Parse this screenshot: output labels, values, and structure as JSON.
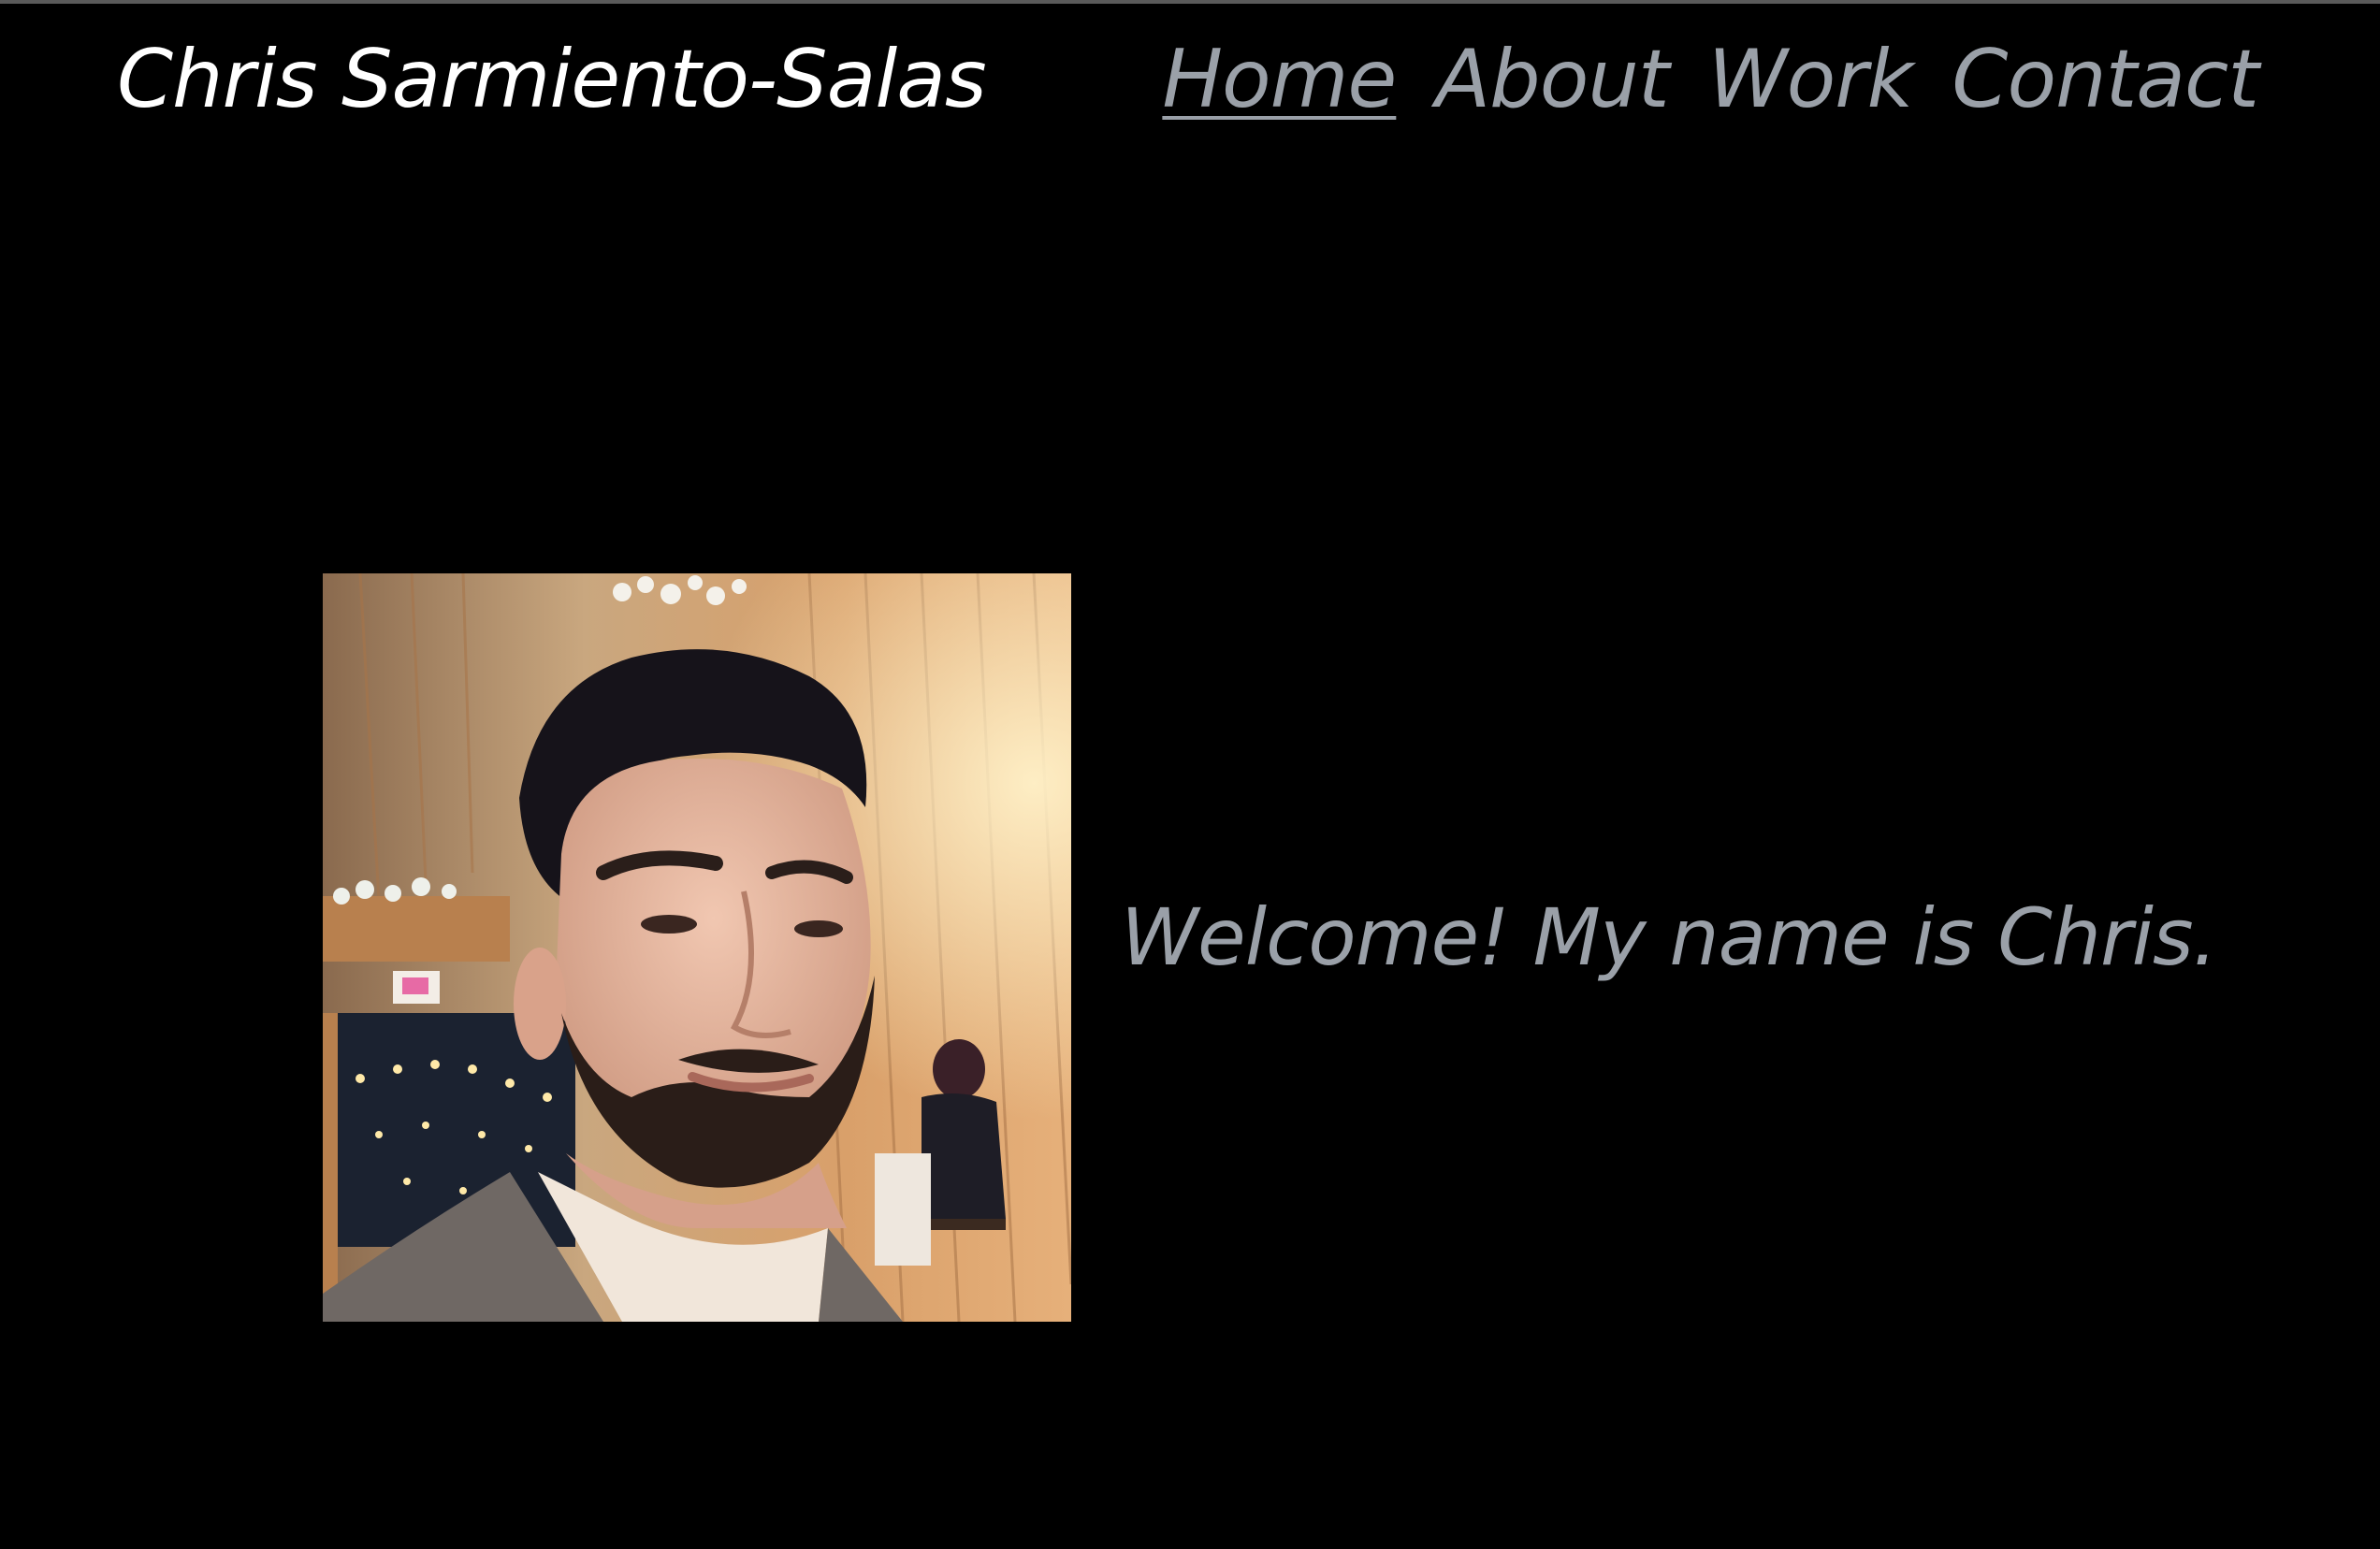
{
  "header": {
    "brand": "Chris Sarmiento-Salas",
    "nav": [
      {
        "label": "Home",
        "active": true
      },
      {
        "label": "About",
        "active": false
      },
      {
        "label": "Work",
        "active": false
      },
      {
        "label": "Contact",
        "active": false
      }
    ]
  },
  "main": {
    "welcome_text": "Welcome! My name is Chris.",
    "profile_photo_alt": "Profile photo of Chris"
  },
  "colors": {
    "background": "#000000",
    "brand_text": "#ffffff",
    "nav_text": "#9aa0a8"
  }
}
